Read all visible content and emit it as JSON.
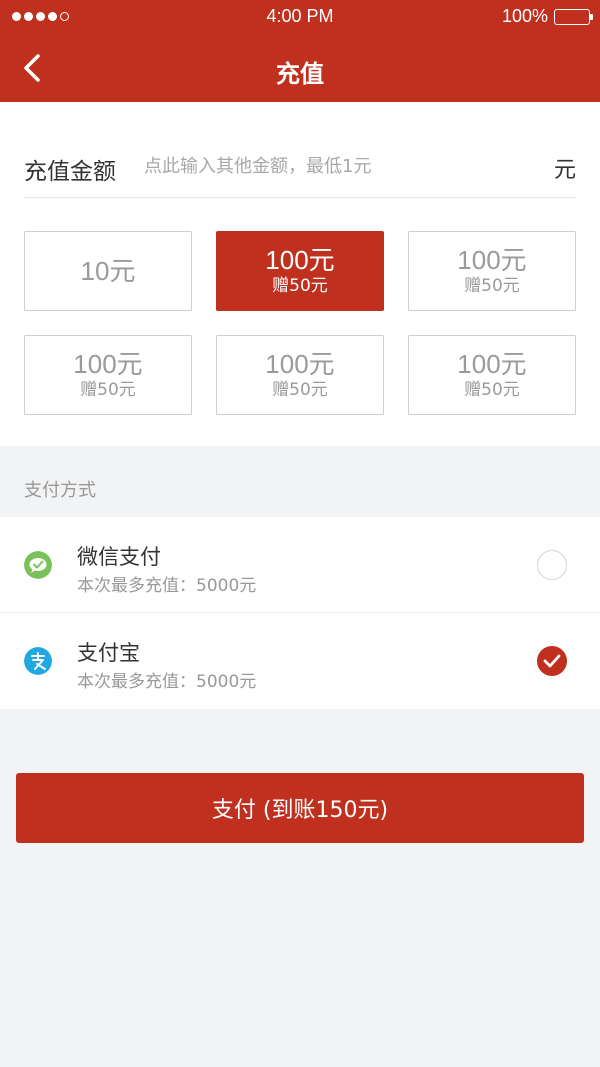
{
  "status_bar": {
    "time": "4:00 PM",
    "battery": "100%"
  },
  "nav": {
    "title": "充值",
    "back_icon": "chevron-left-icon"
  },
  "amount": {
    "label": "充值金额",
    "placeholder": "点此输入其他金额，最低1元",
    "value": "",
    "unit": "元"
  },
  "options": [
    {
      "amount": "10元",
      "bonus": "",
      "selected": false
    },
    {
      "amount": "100元",
      "bonus": "赠50元",
      "selected": true
    },
    {
      "amount": "100元",
      "bonus": "赠50元",
      "selected": false
    },
    {
      "amount": "100元",
      "bonus": "赠50元",
      "selected": false
    },
    {
      "amount": "100元",
      "bonus": "赠50元",
      "selected": false
    },
    {
      "amount": "100元",
      "bonus": "赠50元",
      "selected": false
    }
  ],
  "payment": {
    "header": "支付方式",
    "methods": [
      {
        "name": "微信支付",
        "limit": "本次最多充值：5000元",
        "icon": "wechat-pay-icon",
        "icon_color": "#7ac15a",
        "selected": false
      },
      {
        "name": "支付宝",
        "limit": "本次最多充值：5000元",
        "icon": "alipay-icon",
        "icon_color": "#20a8e0",
        "selected": true
      }
    ]
  },
  "submit": {
    "label": "支付 (到账150元)"
  },
  "colors": {
    "accent": "#c0301f",
    "background": "#f2f3f5"
  }
}
